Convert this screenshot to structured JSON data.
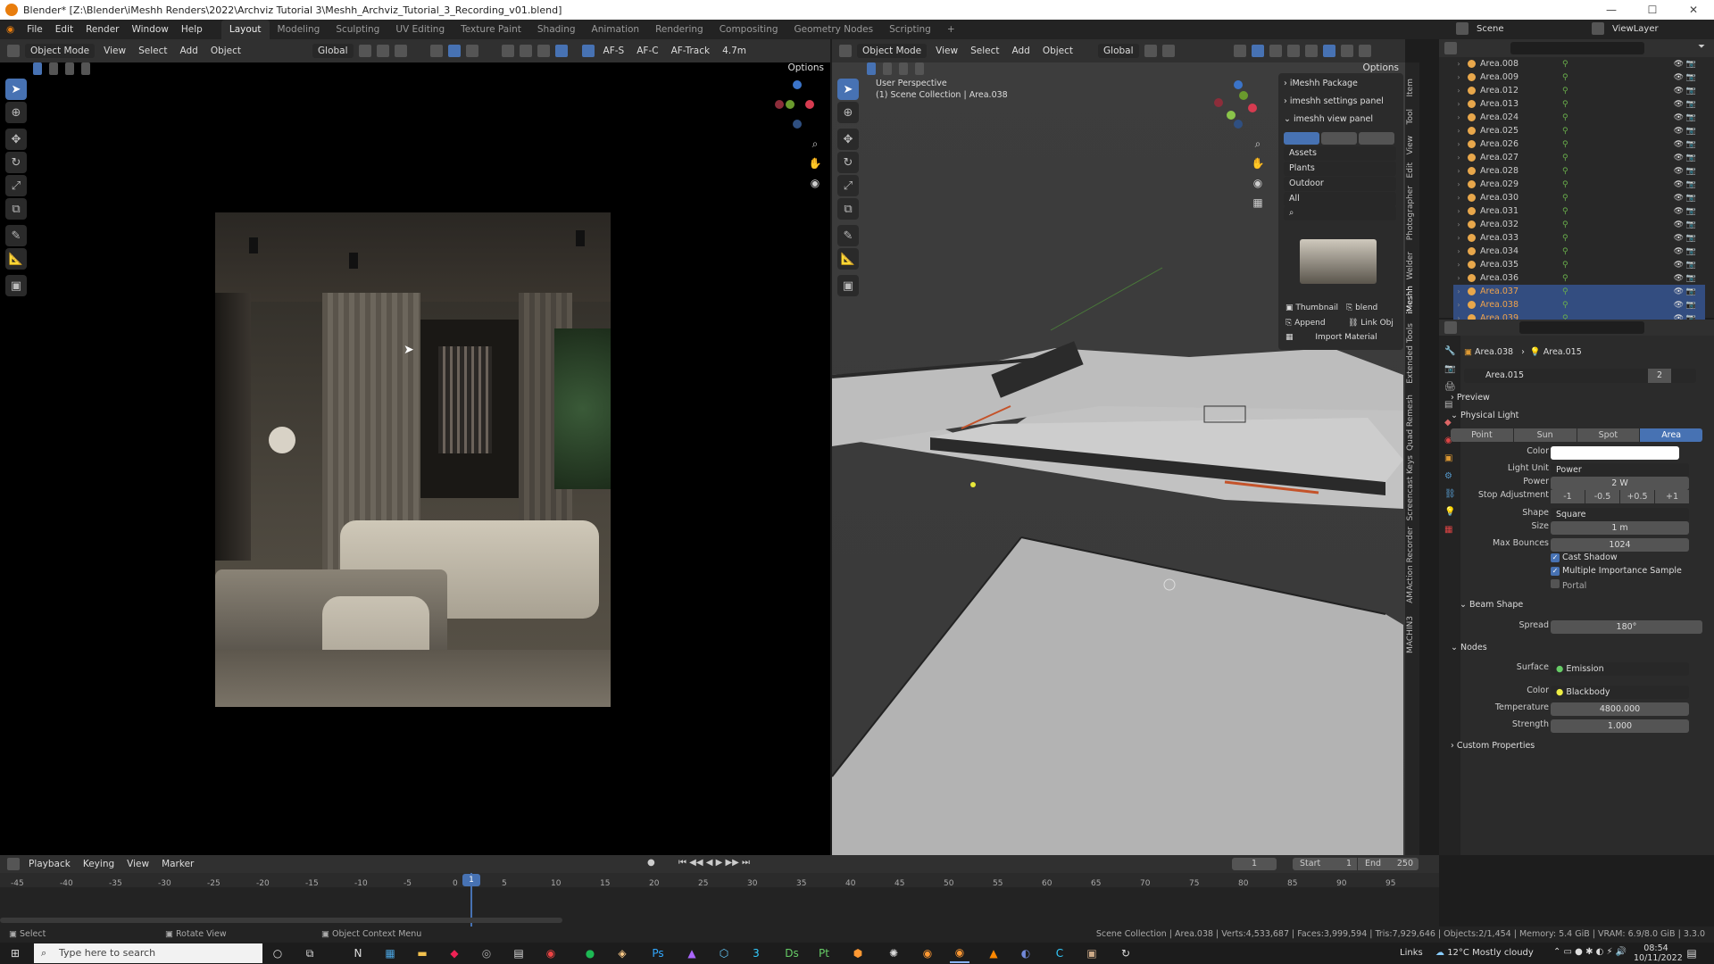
{
  "window": {
    "title": "Blender* [Z:\\Blender\\iMeshh Renders\\2022\\Archviz Tutorial 3\\Meshh_Archviz_Tutorial_3_Recording_v01.blend]"
  },
  "menu": [
    "File",
    "Edit",
    "Render",
    "Window",
    "Help"
  ],
  "workspaces": [
    "Layout",
    "Modeling",
    "Sculpting",
    "UV Editing",
    "Texture Paint",
    "Shading",
    "Animation",
    "Rendering",
    "Compositing",
    "Geometry Nodes",
    "Scripting",
    "+"
  ],
  "scene": {
    "label": "Scene",
    "viewlayer": "ViewLayer"
  },
  "left_view": {
    "mode": "Object Mode",
    "menus": [
      "View",
      "Select",
      "Add",
      "Object"
    ],
    "orientation": "Global",
    "af_s": "AF-S",
    "af_c": "AF-C",
    "af_track": "AF-Track",
    "focal": "4.7m",
    "options": "Options"
  },
  "right_view": {
    "mode": "Object Mode",
    "menus": [
      "View",
      "Select",
      "Add",
      "Object"
    ],
    "orientation": "Global",
    "options": "Options",
    "perspective": "User Perspective",
    "collection": "(1) Scene Collection | Area.038"
  },
  "npanel": {
    "package": "iMeshh Package",
    "settings": "imeshh settings panel",
    "view": "imeshh view panel",
    "assets": "Assets",
    "plants": "Plants",
    "outdoor": "Outdoor",
    "all": "All",
    "thumbnail": "Thumbnail",
    "blend": "blend",
    "append": "Append",
    "link": "Link Obj",
    "import": "Import Material"
  },
  "side_tabs": [
    "Item",
    "Tool",
    "View",
    "Edit",
    "Photographer",
    "Welder",
    "iMeshh",
    "Extended Tools",
    "Quad Remesh",
    "Screencast Keys",
    "Action Recorder",
    "AM",
    "MACHIN3"
  ],
  "outliner": [
    {
      "name": "Area.008",
      "sel": false
    },
    {
      "name": "Area.009",
      "sel": false
    },
    {
      "name": "Area.012",
      "sel": false
    },
    {
      "name": "Area.013",
      "sel": false
    },
    {
      "name": "Area.024",
      "sel": false
    },
    {
      "name": "Area.025",
      "sel": false
    },
    {
      "name": "Area.026",
      "sel": false
    },
    {
      "name": "Area.027",
      "sel": false
    },
    {
      "name": "Area.028",
      "sel": false
    },
    {
      "name": "Area.029",
      "sel": false
    },
    {
      "name": "Area.030",
      "sel": false
    },
    {
      "name": "Area.031",
      "sel": false
    },
    {
      "name": "Area.032",
      "sel": false
    },
    {
      "name": "Area.033",
      "sel": false
    },
    {
      "name": "Area.034",
      "sel": false
    },
    {
      "name": "Area.035",
      "sel": false
    },
    {
      "name": "Area.036",
      "sel": false
    },
    {
      "name": "Area.037",
      "sel": true
    },
    {
      "name": "Area.038",
      "sel": true
    },
    {
      "name": "Area.039",
      "sel": true
    }
  ],
  "props": {
    "crumb_obj": "Area.038",
    "crumb_data": "Area.015",
    "data_name": "Area.015",
    "users": "2",
    "preview": "Preview",
    "physical_light": "Physical Light",
    "types": [
      "Point",
      "Sun",
      "Spot",
      "Area"
    ],
    "color_label": "Color",
    "light_unit_label": "Light Unit",
    "light_unit": "Power",
    "power_label": "Power",
    "power": "2 W",
    "stop_label": "Stop Adjustment",
    "stops": [
      "-1",
      "-0.5",
      "+0.5",
      "+1"
    ],
    "shape_label": "Shape",
    "shape": "Square",
    "size_label": "Size",
    "size": "1 m",
    "bounces_label": "Max Bounces",
    "bounces": "1024",
    "cast_shadow": "Cast Shadow",
    "mis": "Multiple Importance Sample",
    "portal": "Portal",
    "beam_shape": "Beam Shape",
    "spread_label": "Spread",
    "spread": "180°",
    "nodes": "Nodes",
    "surface_label": "Surface",
    "surface": "Emission",
    "ncolor_label": "Color",
    "ncolor": "Blackbody",
    "temp_label": "Temperature",
    "temp": "4800.000",
    "strength_label": "Strength",
    "strength": "1.000",
    "custom": "Custom Properties"
  },
  "timeline": {
    "menus": [
      "Playback",
      "Keying",
      "View",
      "Marker"
    ],
    "frame": "1",
    "start_label": "Start",
    "start": "1",
    "end_label": "End",
    "end": "250",
    "ticks": [
      "-45",
      "-40",
      "-35",
      "-30",
      "-25",
      "-20",
      "-15",
      "-10",
      "-5",
      "0",
      "5",
      "10",
      "15",
      "20",
      "25",
      "30",
      "35",
      "40",
      "45",
      "50",
      "55",
      "60",
      "65",
      "70",
      "75",
      "80",
      "85",
      "90",
      "95"
    ],
    "current": "1"
  },
  "status": {
    "select": "Select",
    "rotate": "Rotate View",
    "context": "Object Context Menu",
    "info": "Scene Collection | Area.038 | Verts:4,533,687 | Faces:3,999,594 | Tris:7,929,646 | Objects:2/1,454 | Memory: 5.4 GiB | VRAM: 6.9/8.0 GiB | 3.3.0"
  },
  "taskbar": {
    "search": "Type here to search",
    "links": "Links",
    "weather": "12°C  Mostly cloudy",
    "time": "08:54",
    "date": "10/11/2022"
  }
}
